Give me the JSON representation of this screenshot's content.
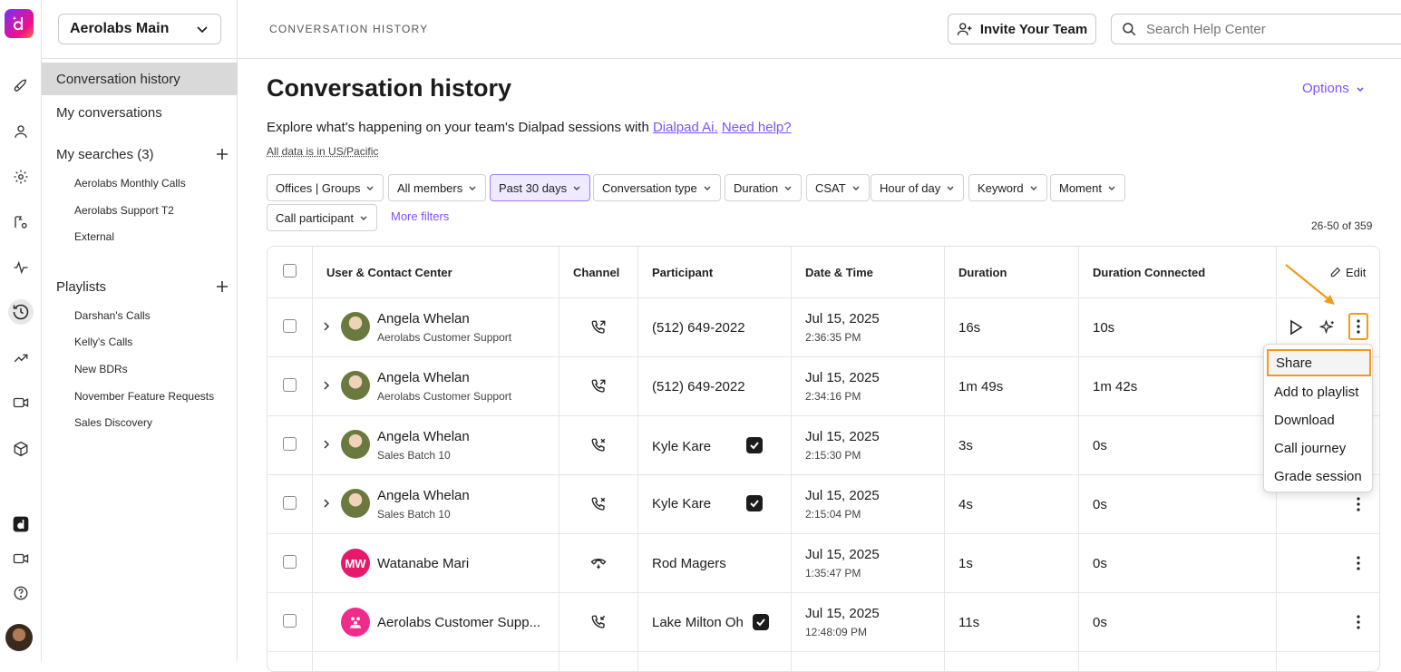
{
  "app": {
    "workspace": "Aerolabs Main",
    "breadcrumb": "CONVERSATION HISTORY"
  },
  "rail": {
    "icons": [
      "logo-icon",
      "rocket-icon",
      "person-icon",
      "gear-icon",
      "routing-icon",
      "activity-icon",
      "history-icon",
      "trending-icon",
      "video-call-icon",
      "box-icon",
      "ai-app-icon",
      "camera-icon",
      "help-icon",
      "user-avatar"
    ]
  },
  "sidebar": {
    "nav": [
      "Conversation history",
      "My conversations"
    ],
    "searches": {
      "label": "My searches (3)",
      "items": [
        "Aerolabs Monthly Calls",
        "Aerolabs Support T2",
        "External"
      ]
    },
    "playlists": {
      "label": "Playlists",
      "items": [
        "Darshan's Calls",
        "Kelly's Calls",
        "New BDRs",
        "November Feature Requests",
        "Sales Discovery"
      ]
    }
  },
  "header": {
    "invite_label": "Invite Your Team",
    "search_placeholder": "Search Help Center"
  },
  "page": {
    "title": "Conversation history",
    "options_label": "Options",
    "desc_text": "Explore what's happening on your team's Dialpad sessions with",
    "desc_link1": "Dialpad Ai.",
    "desc_link2": "Need help?",
    "timezone_note": "All data is in US/Pacific",
    "more_filters": "More filters",
    "count": "26-50 of 359"
  },
  "filters": [
    "Offices | Groups",
    "All members",
    "Past 30 days",
    "Conversation type",
    "Duration",
    "CSAT",
    "Hour of day",
    "Keyword",
    "Moment",
    "Call participant"
  ],
  "table": {
    "columns": [
      "User & Contact Center",
      "Channel",
      "Participant",
      "Date & Time",
      "Duration",
      "Duration Connected"
    ],
    "edit_label": "Edit",
    "rows": [
      {
        "name": "Angela Whelan",
        "center": "Aerolabs Customer Support",
        "channel": "call-outbound-icon",
        "participant": "(512) 649-2022",
        "verified": false,
        "date": "Jul 15, 2025",
        "time": "2:36:35 PM",
        "duration": "16s",
        "connected": "10s"
      },
      {
        "name": "Angela Whelan",
        "center": "Aerolabs Customer Support",
        "channel": "call-outbound-icon",
        "participant": "(512) 649-2022",
        "verified": false,
        "date": "Jul 15, 2025",
        "time": "2:34:16 PM",
        "duration": "1m 49s",
        "connected": "1m 42s"
      },
      {
        "name": "Angela Whelan",
        "center": "Sales Batch 10",
        "channel": "call-missed-icon",
        "participant": "Kyle Kare",
        "verified": true,
        "date": "Jul 15, 2025",
        "time": "2:15:30 PM",
        "duration": "3s",
        "connected": "0s"
      },
      {
        "name": "Angela Whelan",
        "center": "Sales Batch 10",
        "channel": "call-missed-icon",
        "participant": "Kyle Kare",
        "verified": true,
        "date": "Jul 15, 2025",
        "time": "2:15:04 PM",
        "duration": "4s",
        "connected": "0s"
      },
      {
        "name": "Watanabe Mari",
        "initials": "MW",
        "center": "",
        "channel": "call-voicemail-icon",
        "participant": "Rod Magers",
        "verified": false,
        "date": "Jul 15, 2025",
        "time": "1:35:47 PM",
        "duration": "1s",
        "connected": "0s"
      },
      {
        "name": "Aerolabs Customer Supp...",
        "center": "",
        "channel": "call-inbound-icon",
        "participant": "Lake Milton Oh",
        "verified": true,
        "date": "Jul 15, 2025",
        "time": "12:48:09 PM",
        "duration": "11s",
        "connected": "0s"
      }
    ]
  },
  "menu": {
    "items": [
      "Share",
      "Add to playlist",
      "Download",
      "Call journey",
      "Grade session"
    ]
  },
  "colors": {
    "accent": "#7c52ff",
    "highlight": "#f29a1b",
    "brand": "#f10f8a"
  }
}
